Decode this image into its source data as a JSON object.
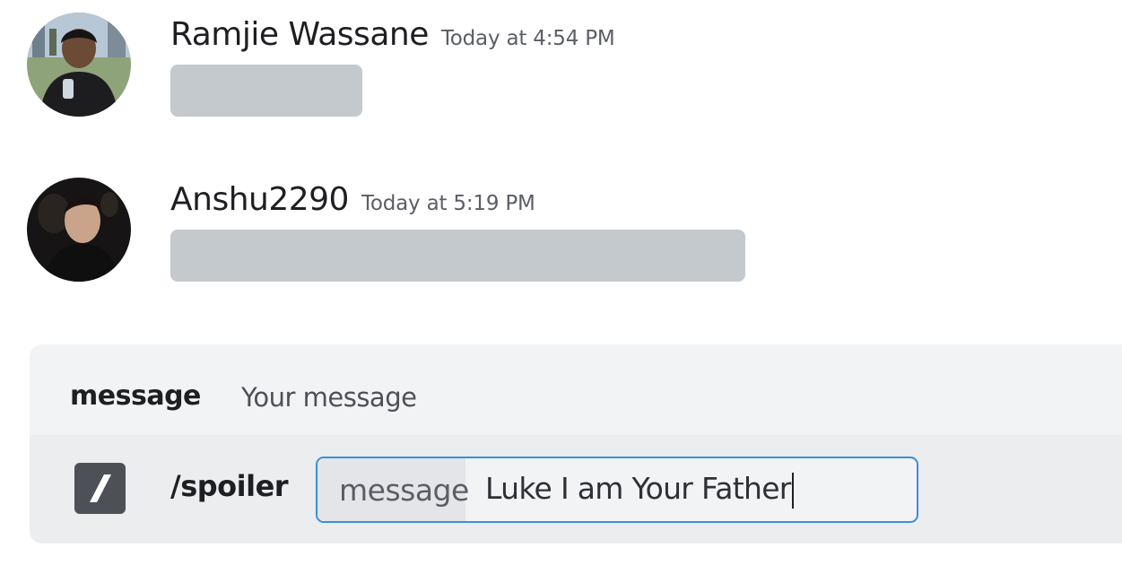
{
  "messages": [
    {
      "username": "Ramjie Wassane",
      "timestamp": "Today at 4:54 PM",
      "avatar_icon": "user-avatar-photo",
      "content_state": "hidden-spoiler"
    },
    {
      "username": "Anshu2290",
      "timestamp": "Today at 5:19 PM",
      "avatar_icon": "user-avatar-photo",
      "content_state": "hidden-spoiler"
    }
  ],
  "command": {
    "option": {
      "name": "message",
      "description": "Your message"
    },
    "icon": "slash-command-icon",
    "name": "/spoiler",
    "param_label": "message",
    "param_value": "Luke I am Your Father"
  },
  "colors": {
    "spoiler": "#c4c9ce",
    "input_border": "#3b8fd9",
    "panel_bg": "#f2f3f5"
  }
}
